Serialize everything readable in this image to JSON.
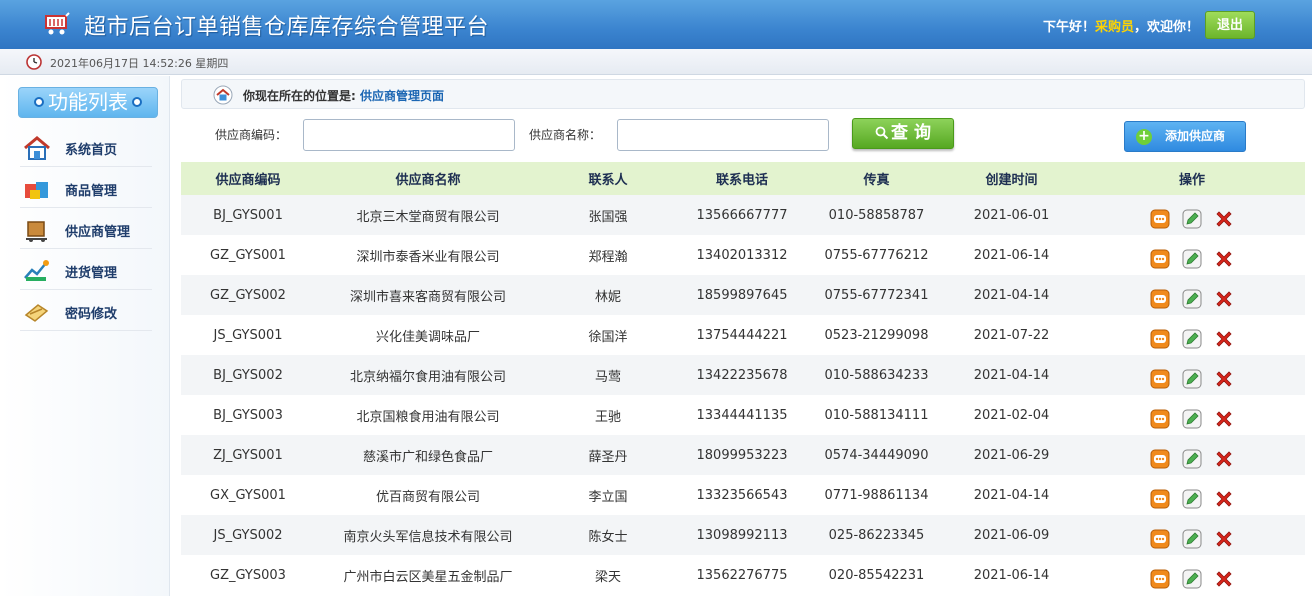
{
  "header": {
    "title": "超市后台订单销售仓库库存综合管理平台",
    "greeting_prefix": "下午好！",
    "role": "采购员",
    "greeting_suffix": "，欢迎你！",
    "logout_label": "退出"
  },
  "datebar": {
    "datetime": "2021年06月17日 14:52:26 星期四"
  },
  "sidebar": {
    "heading": "功能列表",
    "items": [
      {
        "label": "系统首页",
        "icon": "home-icon"
      },
      {
        "label": "商品管理",
        "icon": "goods-icon"
      },
      {
        "label": "供应商管理",
        "icon": "supplier-icon"
      },
      {
        "label": "进货管理",
        "icon": "purchase-icon"
      },
      {
        "label": "密码修改",
        "icon": "password-icon"
      }
    ]
  },
  "location": {
    "prefix": "你现在所在的位置是:",
    "page": "供应商管理页面"
  },
  "search": {
    "code_label": "供应商编码：",
    "code_value": "",
    "name_label": "供应商名称：",
    "name_value": "",
    "query_label": "查 询",
    "add_label": "添加供应商"
  },
  "table": {
    "columns": [
      "供应商编码",
      "供应商名称",
      "联系人",
      "联系电话",
      "传真",
      "创建时间",
      "操作"
    ],
    "rows": [
      [
        "BJ_GYS001",
        "北京三木堂商贸有限公司",
        "张国强",
        "13566667777",
        "010-58858787",
        "2021-06-01"
      ],
      [
        "GZ_GYS001",
        "深圳市泰香米业有限公司",
        "郑程瀚",
        "13402013312",
        "0755-67776212",
        "2021-06-14"
      ],
      [
        "GZ_GYS002",
        "深圳市喜来客商贸有限公司",
        "林妮",
        "18599897645",
        "0755-67772341",
        "2021-04-14"
      ],
      [
        "JS_GYS001",
        "兴化佳美调味品厂",
        "徐国洋",
        "13754444221",
        "0523-21299098",
        "2021-07-22"
      ],
      [
        "BJ_GYS002",
        "北京纳福尔食用油有限公司",
        "马莺",
        "13422235678",
        "010-588634233",
        "2021-04-14"
      ],
      [
        "BJ_GYS003",
        "北京国粮食用油有限公司",
        "王驰",
        "13344441135",
        "010-588134111",
        "2021-02-04"
      ],
      [
        "ZJ_GYS001",
        "慈溪市广和绿色食品厂",
        "薛圣丹",
        "18099953223",
        "0574-34449090",
        "2021-06-29"
      ],
      [
        "GX_GYS001",
        "优百商贸有限公司",
        "李立国",
        "13323566543",
        "0771-98861134",
        "2021-04-14"
      ],
      [
        "JS_GYS002",
        "南京火头军信息技术有限公司",
        "陈女士",
        "13098992113",
        "025-86223345",
        "2021-06-09"
      ],
      [
        "GZ_GYS003",
        "广州市白云区美星五金制品厂",
        "梁天",
        "13562276775",
        "020-85542231",
        "2021-06-14"
      ]
    ],
    "row_actions": [
      "view-icon",
      "edit-icon",
      "delete-icon"
    ]
  },
  "colors": {
    "header_blue": "#3b84cf",
    "table_header": "#e3f3cf",
    "accent_green": "#6cb52c",
    "role_yellow": "#ffd400"
  }
}
